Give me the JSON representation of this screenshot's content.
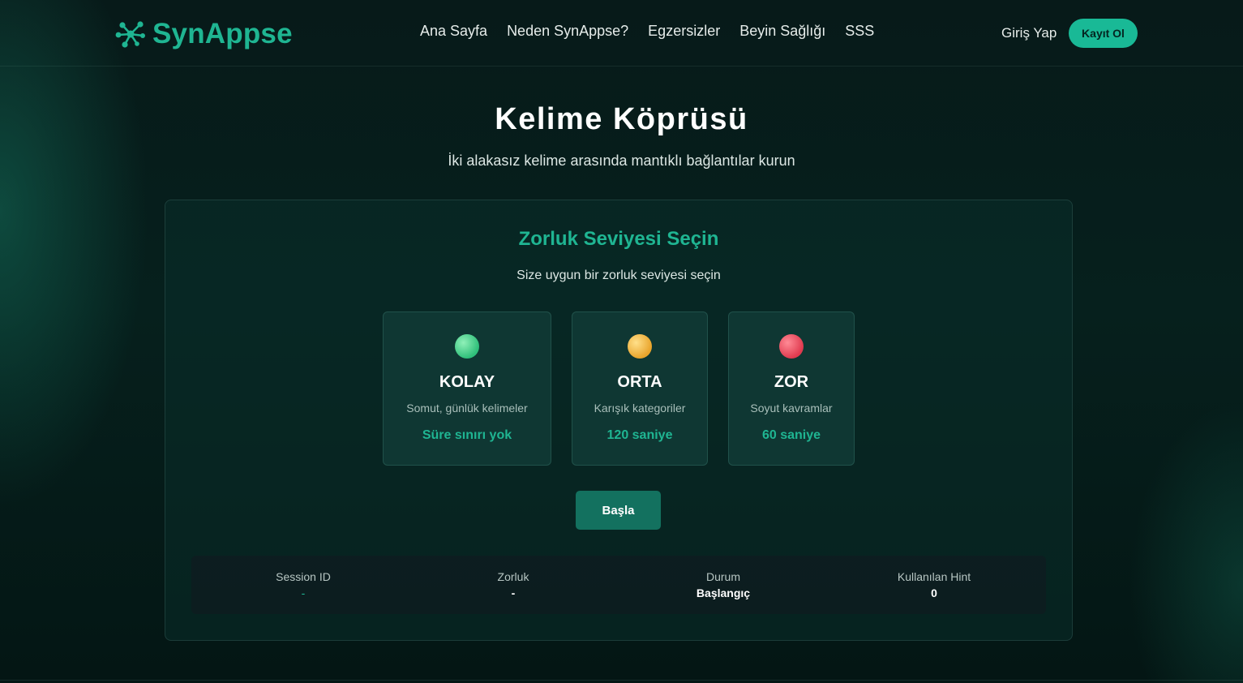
{
  "brand": {
    "name": "SynAppse"
  },
  "nav": {
    "links": [
      "Ana Sayfa",
      "Neden SynAppse?",
      "Egzersizler",
      "Beyin Sağlığı",
      "SSS"
    ],
    "login": "Giriş Yap",
    "signup": "Kayıt Ol"
  },
  "hero": {
    "title": "Kelime Köprüsü",
    "subtitle": "İki alakasız kelime arasında mantıklı bağlantılar kurun"
  },
  "difficulty": {
    "title": "Zorluk Seviyesi Seçin",
    "subtitle": "Size uygun bir zorluk seviyesi seçin",
    "options": [
      {
        "name": "KOLAY",
        "desc": "Somut, günlük kelimeler",
        "time": "Süre sınırı yok",
        "color": "#2fbf7a"
      },
      {
        "name": "ORTA",
        "desc": "Karışık kategoriler",
        "time": "120 saniye",
        "color": "#e9a42b"
      },
      {
        "name": "ZOR",
        "desc": "Soyut kavramlar",
        "time": "60 saniye",
        "color": "#e03a4f"
      }
    ],
    "start_label": "Başla"
  },
  "session": {
    "items": [
      {
        "label": "Session ID",
        "value": "-"
      },
      {
        "label": "Zorluk",
        "value": "-"
      },
      {
        "label": "Durum",
        "value": "Başlangıç"
      },
      {
        "label": "Kullanılan Hint",
        "value": "0"
      }
    ]
  },
  "colors": {
    "accent": "#1fb592",
    "background": "#071a19",
    "button": "#13715f"
  }
}
